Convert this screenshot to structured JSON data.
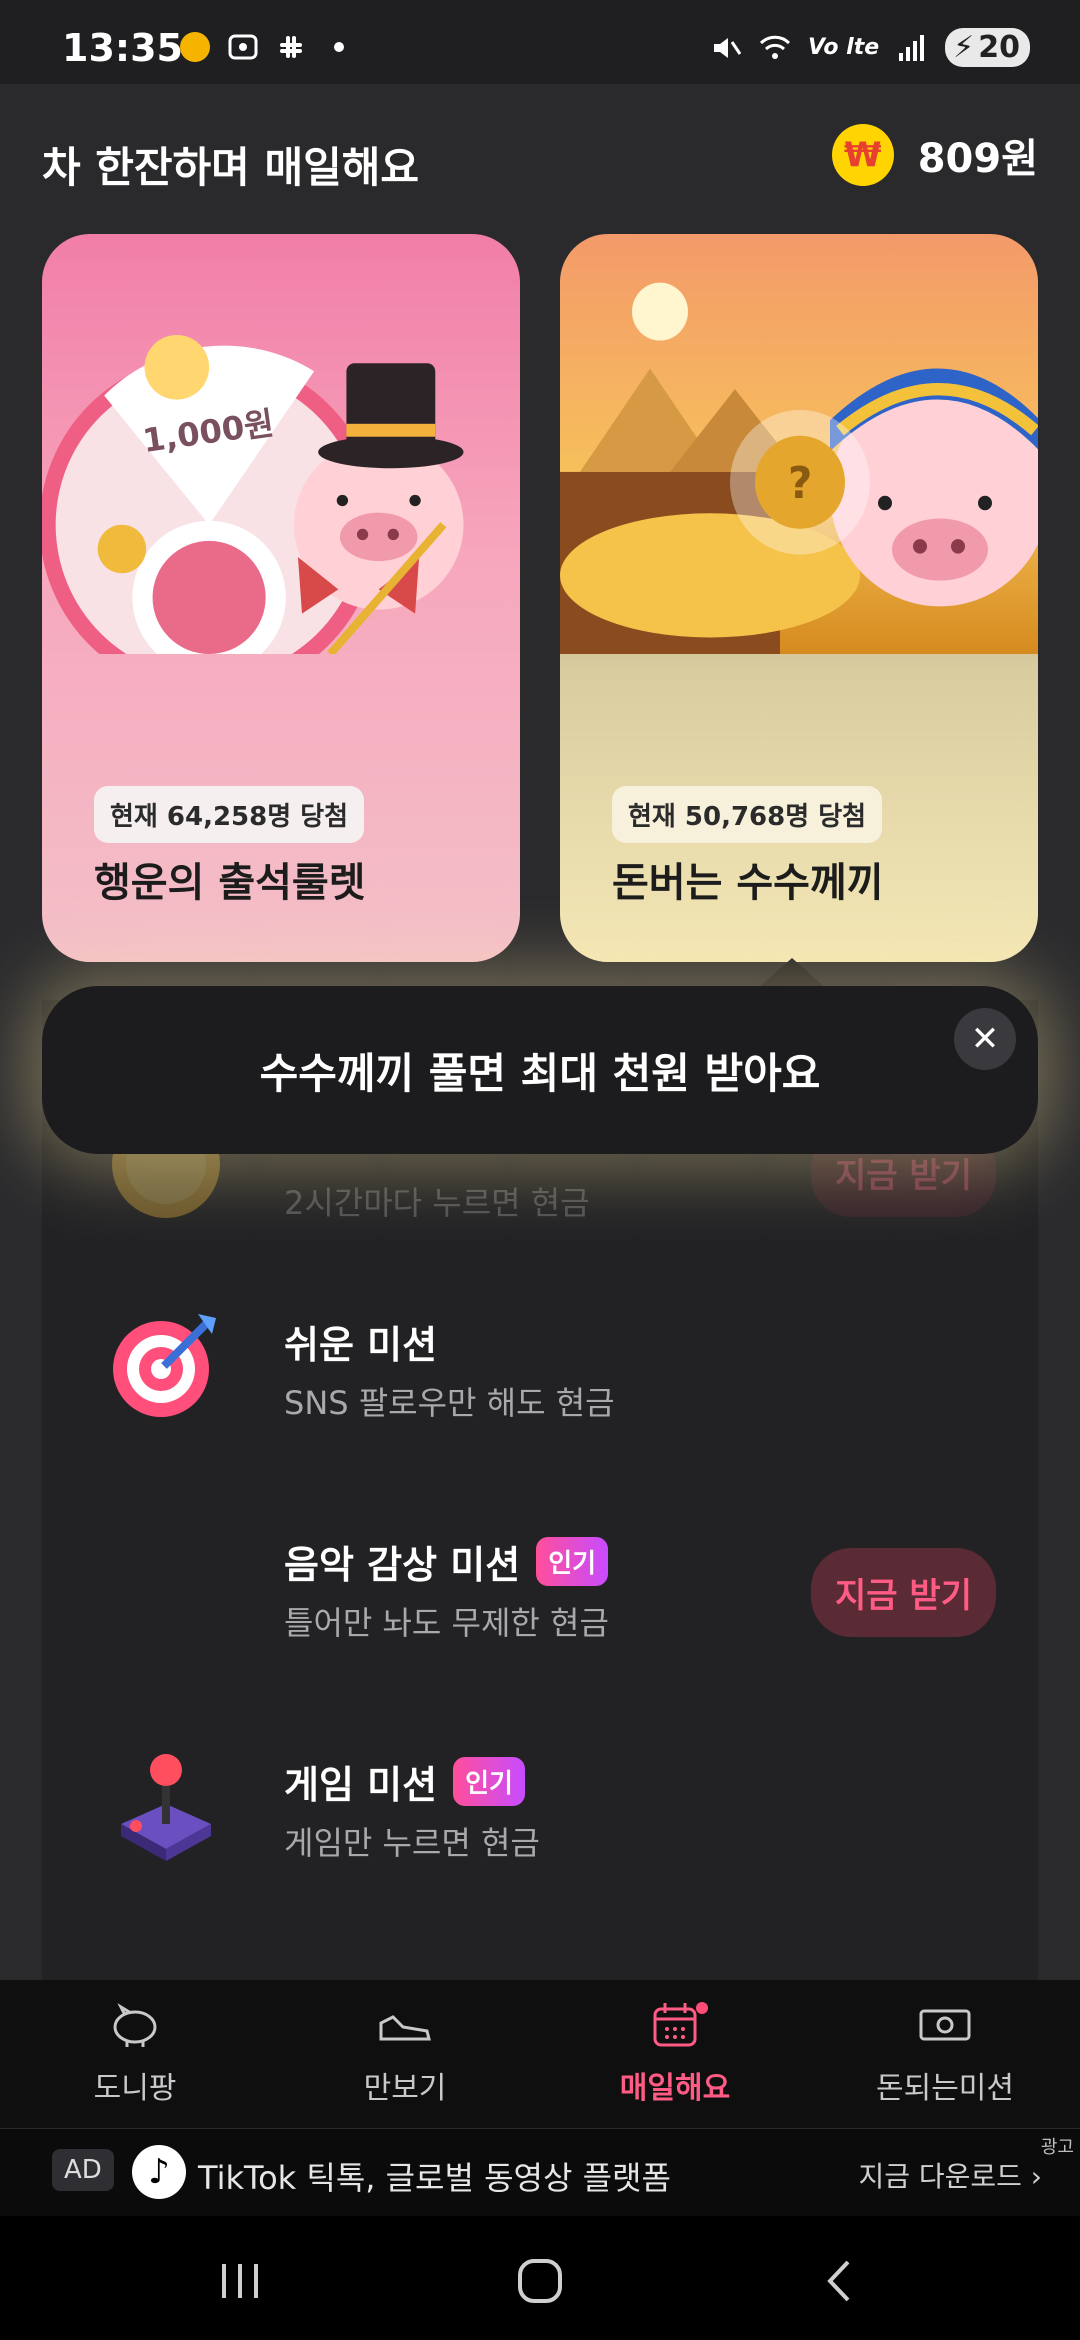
{
  "status_bar": {
    "time": "13:35",
    "battery": "20",
    "icons": [
      "coin-icon",
      "screenshot-icon",
      "slack-icon",
      "dot-icon",
      "mute-icon",
      "wifi-icon",
      "volte-icon",
      "signal-icon",
      "battery-icon"
    ]
  },
  "header": {
    "title": "차 한잔하며 매일해요",
    "balance": "809원",
    "coin_symbol": "₩"
  },
  "cards": [
    {
      "badge": "현재 64,258명 당첨",
      "title": "행운의 출석룰렛",
      "art_text": "1,000원"
    },
    {
      "badge": "현재 50,768명 당첨",
      "title": "돈버는 수수께끼",
      "art_text": "?"
    }
  ],
  "tooltip": {
    "text": "수수께끼 풀면 최대 천원 받아요",
    "close": "✕"
  },
  "missions": [
    {
      "title": "",
      "subtitle": "2시간마다 누르면 현금",
      "button": "지금 받기",
      "icon": "coin-icon"
    },
    {
      "title": "쉬운 미션",
      "subtitle": "SNS 팔로우만 해도 현금",
      "icon": "target-icon"
    },
    {
      "title": "음악 감상 미션",
      "badge": "인기",
      "subtitle": "틀어만 놔도 무제한 현금",
      "button": "지금 받기"
    },
    {
      "title": "게임 미션",
      "badge": "인기",
      "subtitle": "게임만 누르면 현금",
      "icon": "joystick-icon"
    }
  ],
  "bottom_nav": [
    {
      "label": "도니팡",
      "icon": "piggy-bank-icon"
    },
    {
      "label": "만보기",
      "icon": "sneaker-icon"
    },
    {
      "label": "매일해요",
      "icon": "calendar-icon",
      "active": true
    },
    {
      "label": "돈되는미션",
      "icon": "money-bill-icon"
    }
  ],
  "ad": {
    "tag": "AD",
    "text": "TikTok 틱톡, 글로벌 동영상 플랫폼",
    "cta": "지금 다운로드 ›",
    "label": "광고"
  },
  "colors": {
    "accent": "#ff5b84",
    "background": "#2a2a2d",
    "coin": "#ffd400"
  }
}
